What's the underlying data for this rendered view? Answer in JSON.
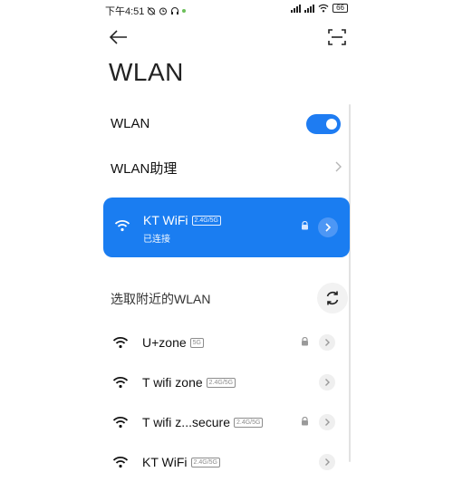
{
  "status_bar": {
    "time": "下午4:51",
    "battery": "66"
  },
  "page": {
    "title": "WLAN"
  },
  "settings": {
    "wlan_label": "WLAN",
    "wlan_enabled": true,
    "assistant_label": "WLAN助理"
  },
  "connected": {
    "name": "KT WiFi",
    "band": "2.4G/5G",
    "status": "已连接",
    "locked": true
  },
  "available_section": {
    "title": "选取附近的WLAN"
  },
  "networks": [
    {
      "name": "U+zone",
      "band": "5G",
      "locked": true
    },
    {
      "name": "T wifi zone",
      "band": "2.4G/5G",
      "locked": false
    },
    {
      "name": "T wifi z...secure",
      "band": "2.4G/5G",
      "locked": true
    },
    {
      "name": "KT WiFi",
      "band": "2.4G/5G",
      "locked": false
    }
  ],
  "colors": {
    "accent": "#1a7df1",
    "toggle": "#1e7cf2"
  },
  "icons": [
    "back-arrow-icon",
    "scan-icon",
    "wifi-icon",
    "lock-icon",
    "chevron-right-icon",
    "refresh-icon"
  ]
}
